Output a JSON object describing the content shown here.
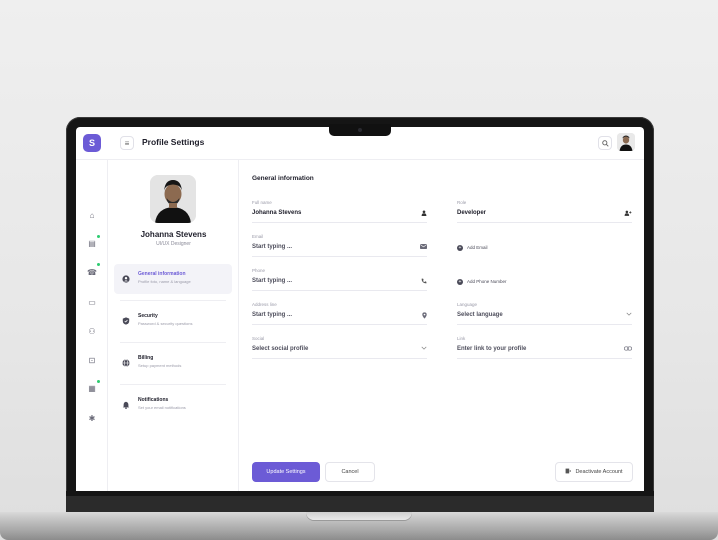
{
  "header": {
    "logo_glyph": "S",
    "title": "Profile Settings",
    "menu_icon": "menu-icon",
    "search_icon": "search-icon"
  },
  "rail": {
    "items": [
      {
        "icon": "home-icon",
        "glyph": "⌂",
        "badge": false
      },
      {
        "icon": "chat-icon",
        "glyph": "▤",
        "badge": true
      },
      {
        "icon": "phone-icon",
        "glyph": "☎",
        "badge": true
      },
      {
        "icon": "devices-icon",
        "glyph": "▭",
        "badge": false
      },
      {
        "icon": "users-icon",
        "glyph": "⚇",
        "badge": false
      },
      {
        "icon": "inbox-icon",
        "glyph": "⊡",
        "badge": false
      },
      {
        "icon": "calendar-icon",
        "glyph": "▦",
        "badge": true
      },
      {
        "icon": "settings-icon",
        "glyph": "✱",
        "badge": false
      }
    ],
    "badge_color": "#2ecc71"
  },
  "profile": {
    "name": "Johanna Stevens",
    "role": "UI/UX Designer"
  },
  "nav": {
    "items": [
      {
        "title": "General information",
        "subtitle": "Profile foto, name & language",
        "icon": "user-circle-icon",
        "active": true
      },
      {
        "title": "Security",
        "subtitle": "Password & security questions",
        "icon": "shield-icon",
        "active": false
      },
      {
        "title": "Billing",
        "subtitle": "Setup payment methods",
        "icon": "globe-icon",
        "active": false
      },
      {
        "title": "Notifications",
        "subtitle": "Set your email notifications",
        "icon": "bell-icon",
        "active": false
      }
    ]
  },
  "form": {
    "section_title": "General information",
    "full_name": {
      "label": "Full name",
      "value": "Johanna Stevens",
      "icon": "person-icon"
    },
    "role": {
      "label": "Role",
      "value": "Developer",
      "icon": "person-plus-icon"
    },
    "email": {
      "label": "Email",
      "placeholder": "Start typing ...",
      "icon": "mail-icon"
    },
    "add_email": "Add Email",
    "phone": {
      "label": "Phone",
      "placeholder": "Start typing ...",
      "icon": "phone-icon"
    },
    "add_phone": "Add Phone Number",
    "address": {
      "label": "Address line",
      "placeholder": "Start typing ...",
      "icon": "pin-icon"
    },
    "language": {
      "label": "Language",
      "placeholder": "Select language",
      "icon": "chevron-down-icon"
    },
    "social": {
      "label": "Social",
      "placeholder": "Select social profile",
      "icon": "chevron-down-icon"
    },
    "link": {
      "label": "Link",
      "placeholder": "Enter link to your profile",
      "icon": "link-icon"
    }
  },
  "actions": {
    "update": "Update Settings",
    "cancel": "Cancel",
    "deactivate": "Deactivate Account"
  },
  "colors": {
    "accent": "#6c5bd6",
    "text": "#1e1e2a",
    "muted": "#9a9aa8"
  }
}
